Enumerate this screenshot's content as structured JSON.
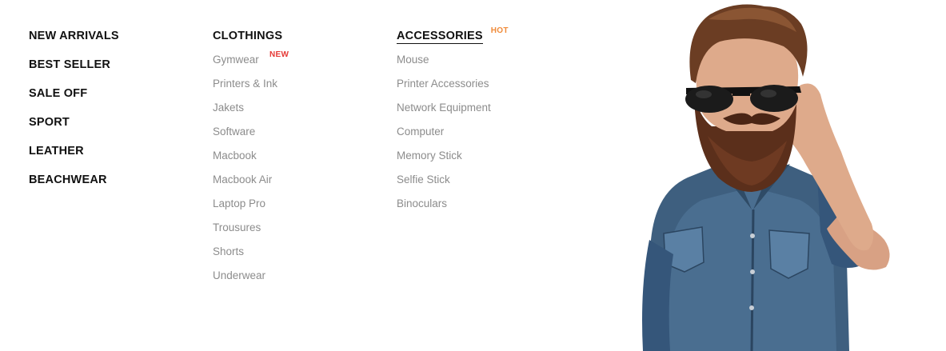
{
  "main_menu": [
    {
      "label": "NEW ARRIVALS"
    },
    {
      "label": "BEST SELLER"
    },
    {
      "label": "SALE OFF"
    },
    {
      "label": "SPORT"
    },
    {
      "label": "LEATHER"
    },
    {
      "label": "BEACHWEAR"
    }
  ],
  "clothing": {
    "heading": "CLOTHINGS",
    "items": [
      {
        "label": "Gymwear",
        "badge": "NEW"
      },
      {
        "label": "Printers & Ink"
      },
      {
        "label": "Jakets"
      },
      {
        "label": "Software"
      },
      {
        "label": "Macbook"
      },
      {
        "label": "Macbook Air"
      },
      {
        "label": "Laptop Pro"
      },
      {
        "label": "Trousures"
      },
      {
        "label": "Shorts"
      },
      {
        "label": "Underwear"
      }
    ]
  },
  "accessories": {
    "heading": "ACCESSORIES",
    "badge": "HOT",
    "items": [
      {
        "label": "Mouse"
      },
      {
        "label": "Printer Accessories"
      },
      {
        "label": "Network Equipment"
      },
      {
        "label": "Computer"
      },
      {
        "label": "Memory Stick"
      },
      {
        "label": "Selfie Stick"
      },
      {
        "label": "Binoculars"
      }
    ]
  },
  "colors": {
    "text_dark": "#111111",
    "text_muted": "#8c8c8c",
    "badge_new": "#e53935",
    "badge_hot": "#f08b3a",
    "background": "#ffffff"
  }
}
